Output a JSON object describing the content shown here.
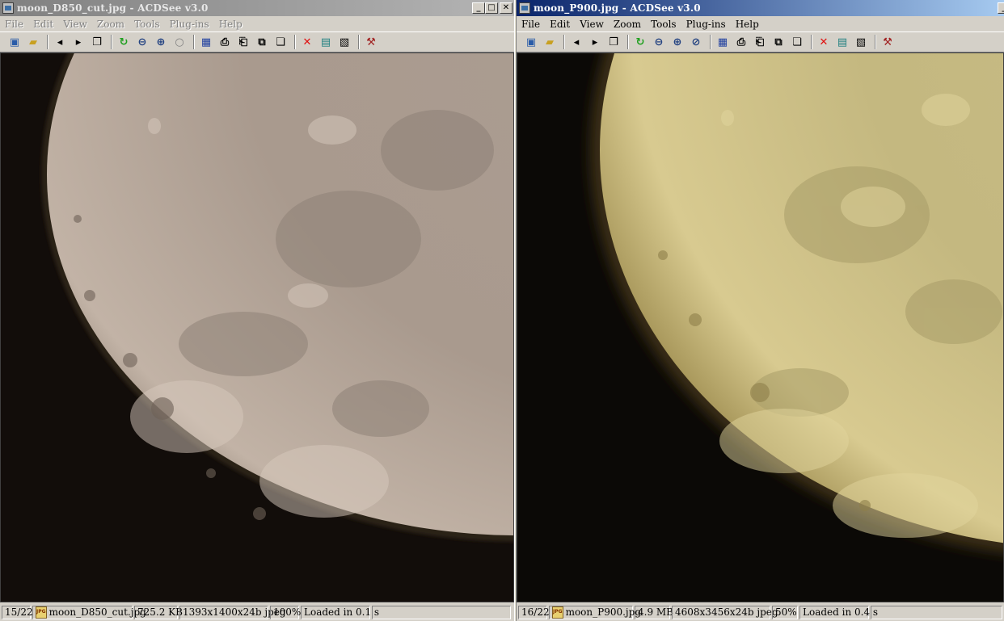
{
  "windows": [
    {
      "title": "moon_D850_cut.jpg - ACDSee v3.0",
      "menu": [
        "File",
        "Edit",
        "View",
        "Zoom",
        "Tools",
        "Plug-ins",
        "Help"
      ],
      "status": {
        "index": "15/22",
        "filename": "moon_D850_cut.jpg",
        "size": "725.2 KB",
        "dimensions": "1393x1400x24b jpeg",
        "zoom": "100%",
        "load": "Loaded in 0.1 s"
      }
    },
    {
      "title": "moon_P900.jpg - ACDSee v3.0",
      "menu": [
        "File",
        "Edit",
        "View",
        "Zoom",
        "Tools",
        "Plug-ins",
        "Help"
      ],
      "status": {
        "index": "16/22",
        "filename": "moon_P900.jpg",
        "size": "4.9 MB",
        "dimensions": "4608x3456x24b jpeg",
        "zoom": "50%",
        "load": "Loaded in 0.4 s"
      }
    }
  ],
  "toolbar_icons": [
    "browse-icon",
    "open-folder-icon",
    "prev-icon",
    "next-icon",
    "slideshow-icon",
    "rotate-icon",
    "zoom-out-icon",
    "zoom-in-icon",
    "zoom-reset-icon",
    "wallpaper-icon",
    "print-icon",
    "scan-icon",
    "copy-icon",
    "paste-icon",
    "delete-icon",
    "rename-icon",
    "properties-icon",
    "tools-icon"
  ],
  "colors": {
    "active_title": "#0a246a",
    "inactive_title": "#808080",
    "moon_left": "#b0a295",
    "moon_right": "#cdc08a"
  }
}
